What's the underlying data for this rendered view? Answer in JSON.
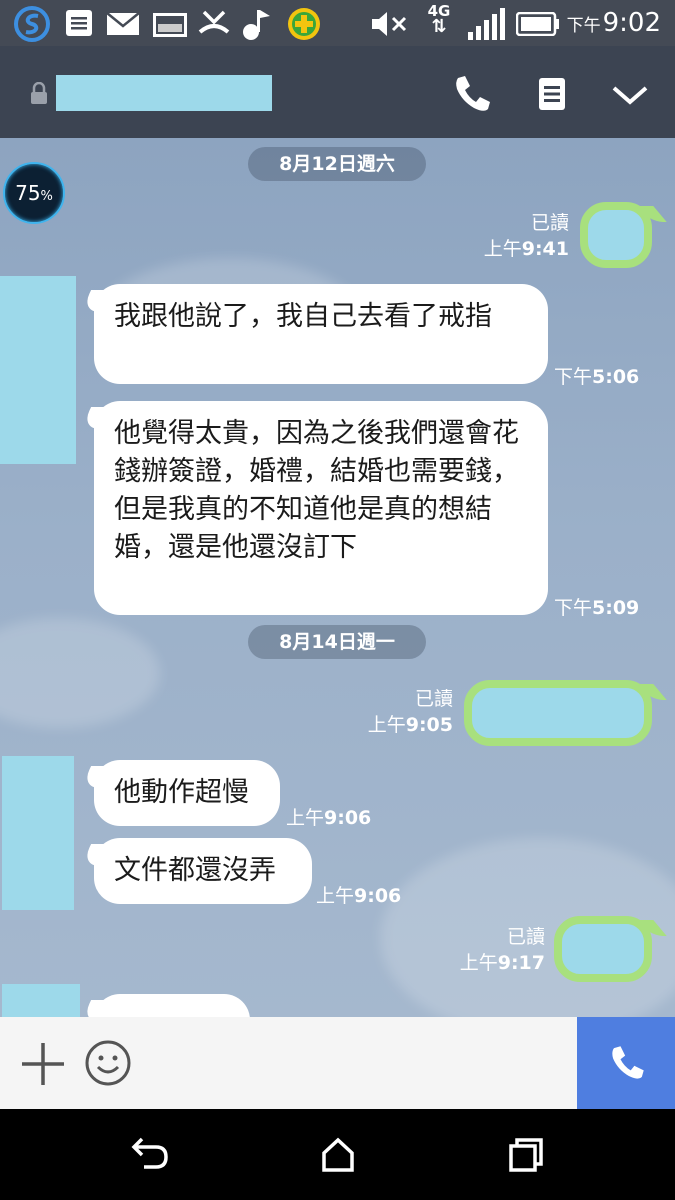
{
  "status_bar": {
    "time_prefix": "下午",
    "time": "9:02",
    "network": "4G"
  },
  "header": {
    "contact_name": ""
  },
  "chat": {
    "badge": {
      "value": "75",
      "unit": "%"
    },
    "messages": [
      {
        "type": "date",
        "text": "8月12日週六"
      },
      {
        "type": "out",
        "read": "已讀",
        "time_prefix": "上午",
        "time": "9:41"
      },
      {
        "type": "in",
        "text": "我跟他說了，我自己去看了戒指",
        "time_prefix": "下午",
        "time": "5:06"
      },
      {
        "type": "in",
        "text": "他覺得太貴，因為之後我們還會花錢辦簽證，婚禮，結婚也需要錢，但是我真的不知道他是真的想結婚，還是他還沒訂下",
        "time_prefix": "下午",
        "time": "5:09"
      },
      {
        "type": "date",
        "text": "8月14日週一"
      },
      {
        "type": "out",
        "read": "已讀",
        "time_prefix": "上午",
        "time": "9:05"
      },
      {
        "type": "in",
        "text": "他動作超慢",
        "time_prefix": "上午",
        "time": "9:06"
      },
      {
        "type": "in",
        "text": "文件都還沒弄",
        "time_prefix": "上午",
        "time": "9:06"
      },
      {
        "type": "out",
        "read": "已讀",
        "time_prefix": "上午",
        "time": "9:17"
      }
    ]
  },
  "input_bar": {
    "plus_icon": "plus-icon",
    "emoji_icon": "emoji-icon",
    "call_icon": "phone-icon"
  },
  "colors": {
    "header": "#3c4452",
    "bubble_out_border": "#a8e07e",
    "redaction": "#9dd9ea",
    "call_button": "#4f7ee0"
  }
}
